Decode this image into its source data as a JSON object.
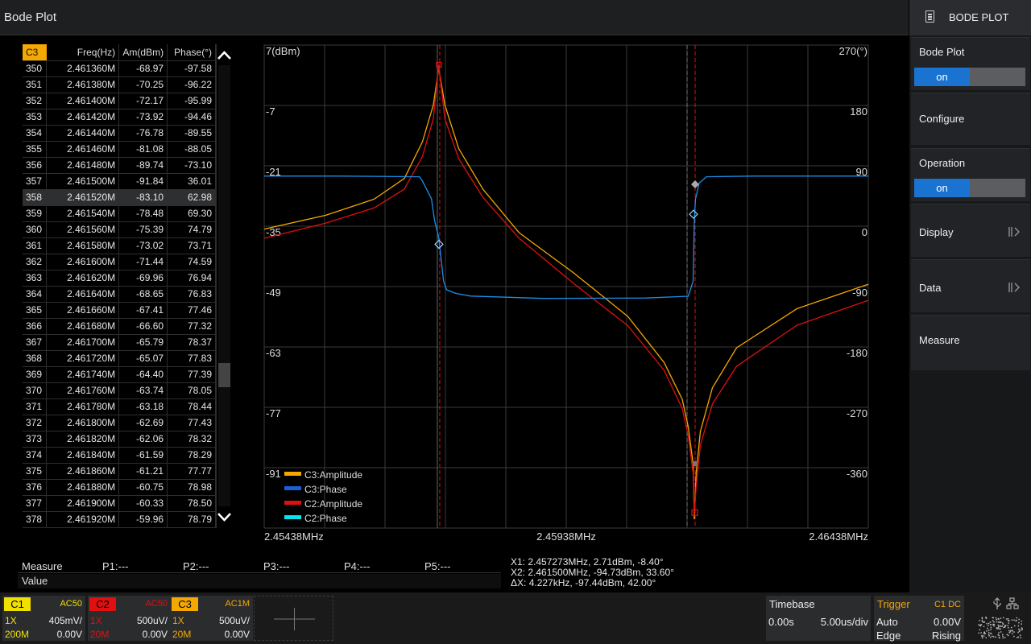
{
  "window": {
    "title": "Bode Plot"
  },
  "right_panel": {
    "header": "BODE PLOT",
    "bode_plot": {
      "label": "Bode Plot",
      "state": "on"
    },
    "configure": "Configure",
    "operation": {
      "label": "Operation",
      "state": "on"
    },
    "display": "Display",
    "data": "Data",
    "measure": "Measure"
  },
  "table": {
    "channel": "C3",
    "headers": [
      "Freq(Hz)",
      "Am(dBm)",
      "Phase(°)"
    ],
    "selected_index": "358",
    "rows": [
      [
        "350",
        "2.461360M",
        "-68.97",
        "-97.58"
      ],
      [
        "351",
        "2.461380M",
        "-70.25",
        "-96.22"
      ],
      [
        "352",
        "2.461400M",
        "-72.17",
        "-95.99"
      ],
      [
        "353",
        "2.461420M",
        "-73.92",
        "-94.46"
      ],
      [
        "354",
        "2.461440M",
        "-76.78",
        "-89.55"
      ],
      [
        "355",
        "2.461460M",
        "-81.08",
        "-88.05"
      ],
      [
        "356",
        "2.461480M",
        "-89.74",
        "-73.10"
      ],
      [
        "357",
        "2.461500M",
        "-91.84",
        "36.01"
      ],
      [
        "358",
        "2.461520M",
        "-83.10",
        "62.98"
      ],
      [
        "359",
        "2.461540M",
        "-78.48",
        "69.30"
      ],
      [
        "360",
        "2.461560M",
        "-75.39",
        "74.79"
      ],
      [
        "361",
        "2.461580M",
        "-73.02",
        "73.71"
      ],
      [
        "362",
        "2.461600M",
        "-71.44",
        "74.59"
      ],
      [
        "363",
        "2.461620M",
        "-69.96",
        "76.94"
      ],
      [
        "364",
        "2.461640M",
        "-68.65",
        "76.83"
      ],
      [
        "365",
        "2.461660M",
        "-67.41",
        "77.46"
      ],
      [
        "366",
        "2.461680M",
        "-66.60",
        "77.32"
      ],
      [
        "367",
        "2.461700M",
        "-65.79",
        "78.37"
      ],
      [
        "368",
        "2.461720M",
        "-65.07",
        "77.83"
      ],
      [
        "369",
        "2.461740M",
        "-64.40",
        "77.39"
      ],
      [
        "370",
        "2.461760M",
        "-63.74",
        "78.05"
      ],
      [
        "371",
        "2.461780M",
        "-63.18",
        "78.44"
      ],
      [
        "372",
        "2.461800M",
        "-62.69",
        "77.43"
      ],
      [
        "373",
        "2.461820M",
        "-62.06",
        "78.32"
      ],
      [
        "374",
        "2.461840M",
        "-61.59",
        "78.29"
      ],
      [
        "375",
        "2.461860M",
        "-61.21",
        "77.77"
      ],
      [
        "376",
        "2.461880M",
        "-60.75",
        "78.98"
      ],
      [
        "377",
        "2.461900M",
        "-60.33",
        "78.50"
      ],
      [
        "378",
        "2.461920M",
        "-59.96",
        "78.79"
      ]
    ]
  },
  "chart_data": {
    "type": "line",
    "x_ticks": [
      "2.45438MHz",
      "2.45938MHz",
      "2.46438MHz"
    ],
    "xlim_mhz": [
      2.45438,
      2.46438
    ],
    "y_left_ticks": [
      "7(dBm)",
      "-7",
      "-21",
      "-35",
      "-49",
      "-63",
      "-77",
      "-91"
    ],
    "ylim_left": [
      -98,
      7
    ],
    "y_right_ticks": [
      "270(°)",
      "180",
      "90",
      "0",
      "-90",
      "-180",
      "-270",
      "-360"
    ],
    "ylim_right": [
      -405,
      270
    ],
    "grid": true,
    "legend_position": "bottom-left",
    "legend": [
      {
        "name": "C3:Amplitude",
        "color": "#f5a800"
      },
      {
        "name": "C3:Phase",
        "color": "#1a5fd8"
      },
      {
        "name": "C2:Amplitude",
        "color": "#e01010"
      },
      {
        "name": "C2:Phase",
        "color": "#00e5f0"
      }
    ],
    "cursors_mhz": [
      2.457273,
      2.4615
    ],
    "series": [
      {
        "name": "C3:Amplitude",
        "color": "#f5a800",
        "x": [
          2.45438,
          2.4554,
          2.4562,
          2.4567,
          2.457,
          2.45718,
          2.45727,
          2.45737,
          2.4576,
          2.458,
          2.4586,
          2.4595,
          2.4604,
          2.461,
          2.4613,
          2.4614,
          2.46148,
          2.4615,
          2.46153,
          2.4616,
          2.4618,
          2.4622,
          2.4632,
          2.46438
        ],
        "y": [
          -33,
          -30,
          -26.5,
          -22,
          -14,
          -6,
          2,
          -6,
          -15.5,
          -24.3,
          -33.8,
          -42.5,
          -52,
          -62,
          -70,
          -76,
          -84,
          -96,
          -86,
          -77,
          -67.5,
          -58.8,
          -50.3,
          -45
        ]
      },
      {
        "name": "C2:Amplitude",
        "color": "#e01010",
        "x": [
          2.45438,
          2.4554,
          2.4562,
          2.4567,
          2.457,
          2.45718,
          2.45727,
          2.45737,
          2.4576,
          2.458,
          2.4586,
          2.4595,
          2.4604,
          2.461,
          2.4613,
          2.4614,
          2.46148,
          2.4615,
          2.46153,
          2.4616,
          2.4618,
          2.4622,
          2.4632,
          2.46438
        ],
        "y": [
          -35,
          -31.7,
          -28.4,
          -24.3,
          -17.2,
          -9,
          2.7,
          -9,
          -17.7,
          -26.1,
          -35,
          -44.8,
          -54,
          -63.7,
          -72,
          -78,
          -86,
          -95,
          -89,
          -80,
          -71,
          -62.8,
          -53.9,
          -48.5
        ]
      },
      {
        "name": "C3:Phase",
        "color": "#1a8fe8",
        "x": [
          2.45438,
          2.4556,
          2.45695,
          2.457,
          2.45715,
          2.4572,
          2.45727,
          2.45735,
          2.4574,
          2.45755,
          2.4578,
          2.459,
          2.4607,
          2.4614,
          2.46148,
          2.4615,
          2.46152,
          2.46158,
          2.4617,
          2.4625,
          2.46438
        ],
        "y": [
          87,
          87,
          86,
          80,
          55,
          25,
          1,
          -60,
          -72,
          -77,
          -80.8,
          -84,
          -83.5,
          -81,
          -60,
          25,
          55,
          77,
          86,
          87,
          87
        ]
      }
    ]
  },
  "measure": {
    "label": "Measure",
    "value_label": "Value",
    "items": [
      "P1:---",
      "P2:---",
      "P3:---",
      "P4:---",
      "P5:---"
    ]
  },
  "cursor_readout": {
    "x1": "X1: 2.457273MHz, 2.71dBm, -8.40°",
    "x2": "X2: 2.461500MHz, -94.73dBm, 33.60°",
    "dx": "ΔX: 4.227kHz, -97.44dBm, 42.00°"
  },
  "channels": [
    {
      "tag": "C1",
      "coupling": "AC50",
      "probe": "1X",
      "scale": "405mV/",
      "bw": "200M",
      "offset": "0.00V",
      "color": "#f0e000",
      "tag_text": "#000"
    },
    {
      "tag": "C2",
      "coupling": "AC50",
      "probe": "1X",
      "scale": "500uV/",
      "bw": "20M",
      "offset": "0.00V",
      "color": "#e01010",
      "tag_text": "#000"
    },
    {
      "tag": "C3",
      "coupling": "AC1M",
      "probe": "1X",
      "scale": "500uV/",
      "bw": "20M",
      "offset": "0.00V",
      "color": "#f5a800",
      "tag_text": "#000"
    }
  ],
  "timebase": {
    "label": "Timebase",
    "delay": "0.00s",
    "scale": "5.00us/div"
  },
  "trigger": {
    "label": "Trigger",
    "source": "C1 DC",
    "mode": "Auto",
    "level": "0.00V",
    "type": "Edge",
    "slope": "Rising"
  }
}
